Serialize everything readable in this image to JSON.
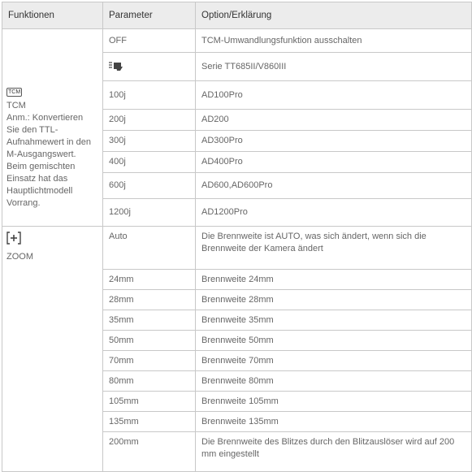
{
  "headers": [
    "Funktionen",
    "Parameter",
    "Option/Erklärung"
  ],
  "tcm": {
    "icon": "TCM",
    "label": "TCM",
    "note": "Anm.: Konvertieren Sie den TTL-Aufnahmewert in den M-Ausgangswert. Beim gemischten Einsatz hat das Hauptlichtmodell Vorrang.",
    "rows": [
      {
        "param": "OFF",
        "desc": "TCM-Umwandlungsfunktion ausschalten"
      },
      {
        "param": "",
        "param_icon": "high-speed-sync-icon",
        "desc": "Serie TT685II/V860III"
      },
      {
        "param": "100j",
        "desc": "AD100Pro"
      },
      {
        "param": "200j",
        "desc": "AD200"
      },
      {
        "param": "300j",
        "desc": "AD300Pro"
      },
      {
        "param": "400j",
        "desc": "AD400Pro"
      },
      {
        "param": "600j",
        "desc": "AD600,AD600Pro"
      },
      {
        "param": "1200j",
        "desc": "AD1200Pro"
      }
    ]
  },
  "zoom": {
    "icon": "zoom-plus-icon",
    "label": "ZOOM",
    "rows": [
      {
        "param": "Auto",
        "desc": "Die Brennweite ist AUTO, was sich ändert, wenn sich die Brennweite der Kamera ändert"
      },
      {
        "param": "24mm",
        "desc": "Brennweite 24mm"
      },
      {
        "param": "28mm",
        "desc": "Brennweite 28mm"
      },
      {
        "param": "35mm",
        "desc": "Brennweite 35mm"
      },
      {
        "param": "50mm",
        "desc": "Brennweite 50mm"
      },
      {
        "param": "70mm",
        "desc": "Brennweite 70mm"
      },
      {
        "param": "80mm",
        "desc": "Brennweite 80mm"
      },
      {
        "param": "105mm",
        "desc": "Brennweite 105mm"
      },
      {
        "param": "135mm",
        "desc": "Brennweite 135mm"
      },
      {
        "param": "200mm",
        "desc": "Die Brennweite des Blitzes durch den Blitzauslöser wird auf 200 mm eingestellt"
      }
    ]
  }
}
